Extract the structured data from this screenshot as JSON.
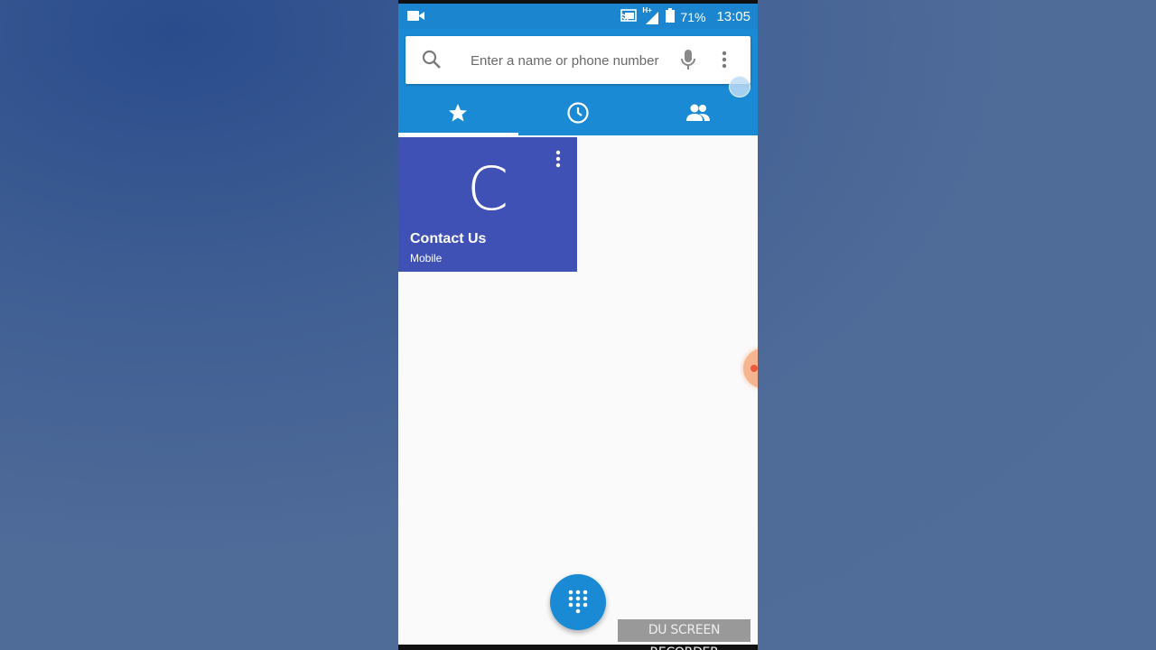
{
  "status_bar": {
    "battery": "71%",
    "time": "13:05",
    "network_badge": "H+",
    "icons": [
      "video-camera-icon",
      "cast-icon",
      "signal-icon",
      "battery-icon"
    ]
  },
  "search": {
    "placeholder": "Enter a name or phone number",
    "value": ""
  },
  "tabs": [
    {
      "icon": "star-icon",
      "name": "Speed dial",
      "selected": true
    },
    {
      "icon": "clock-icon",
      "name": "Recents",
      "selected": false
    },
    {
      "icon": "people-icon",
      "name": "Contacts",
      "selected": false
    }
  ],
  "favorites": [
    {
      "letter": "C",
      "name": "Contact Us",
      "type": "Mobile",
      "color": "#3f51b5"
    }
  ],
  "fab": {
    "icon": "dialpad-icon"
  },
  "watermark": "DU SCREEN RECORDER",
  "colors": {
    "accent": "#1b8ad4",
    "status_bar": "#1b86cf",
    "tile": "#3f51b5",
    "background": "#fafafa",
    "desktop": "#4f6b98"
  }
}
